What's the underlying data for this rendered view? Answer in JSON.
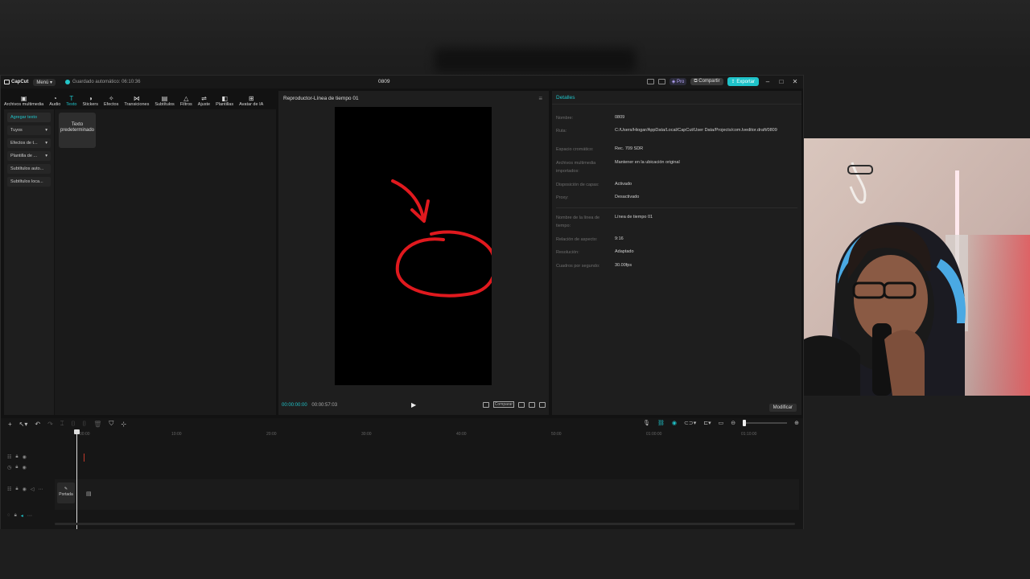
{
  "titlebar": {
    "app_name": "CapCut",
    "menu_label": "Menú",
    "autosave_text": "Guardado automático: 06:10:36",
    "project_title": "0809",
    "pro_label": "Pro",
    "share_label": "Compartir",
    "export_label": "Exportar"
  },
  "toolbar": {
    "tools": [
      {
        "label": "Archivos multimedia",
        "icon": "media-icon"
      },
      {
        "label": "Audio",
        "icon": "audio-icon"
      },
      {
        "label": "Texto",
        "icon": "text-icon"
      },
      {
        "label": "Stickers",
        "icon": "sticker-icon"
      },
      {
        "label": "Efectos",
        "icon": "effects-icon"
      },
      {
        "label": "Transiciones",
        "icon": "transitions-icon"
      },
      {
        "label": "Subtítulos",
        "icon": "captions-icon"
      },
      {
        "label": "Filtros",
        "icon": "filters-icon"
      },
      {
        "label": "Ajuste",
        "icon": "adjust-icon"
      },
      {
        "label": "Plantillas",
        "icon": "templates-icon"
      },
      {
        "label": "Avatar de IA",
        "icon": "ai-avatar-icon"
      }
    ],
    "active_index": 2
  },
  "leftnav": {
    "items": [
      "Agregar texto",
      "Tuyos",
      "Efectos de t...",
      "Plantilla de ...",
      "Subtítulos auto...",
      "Subtítulos loca..."
    ]
  },
  "text_panel": {
    "default_card": "Texto predeterminado"
  },
  "player": {
    "title": "Reproductor-Línea de tiempo 01",
    "current_time": "00:00:00:00",
    "total_time": "00:00:57:03",
    "compare_label": "Comparar"
  },
  "details": {
    "title": "Detalles",
    "rows": [
      {
        "k": "Nombre:",
        "v": "0809"
      },
      {
        "k": "Ruta:",
        "v": "C:/Users/Hiogar/AppData/Local/CapCut/User Data/Projects/com.lveditor.draft/0809"
      },
      {
        "k": "Espacio cromático:",
        "v": "Rec. 709 SDR"
      },
      {
        "k": "Archivos multimedia importados:",
        "v": "Mantener en la ubicación original"
      },
      {
        "k": "Disposición de capas:",
        "v": "Activado"
      },
      {
        "k": "Proxy:",
        "v": "Desactivado"
      },
      {
        "k": "Nombre de la línea de tiempo:",
        "v": "Línea de tiempo 01"
      },
      {
        "k": "Relación de aspecto:",
        "v": "9:16"
      },
      {
        "k": "Resolución:",
        "v": "Adaptado"
      },
      {
        "k": "Cuadros por segundo:",
        "v": "30.00fps"
      }
    ],
    "modify_label": "Modificar"
  },
  "timeline": {
    "ruler_marks": [
      "00:00",
      "10:00",
      "20:00",
      "30:00",
      "40:00",
      "50:00",
      "01:00:00",
      "01:10:00"
    ],
    "cover_label": "Portada"
  },
  "colors": {
    "accent": "#1fc3c9",
    "annotation_red": "#e0191e"
  }
}
